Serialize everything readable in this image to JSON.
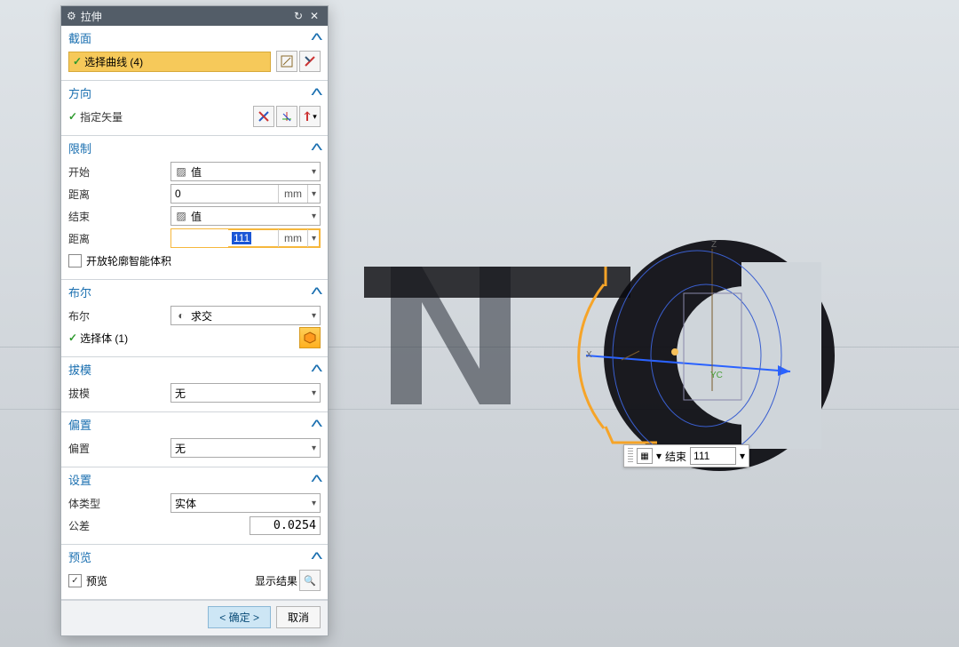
{
  "dialog": {
    "title": "拉伸",
    "sections": {
      "section_profile": {
        "title": "截面",
        "selectCurve": "选择曲线 (4)"
      },
      "section_direction": {
        "title": "方向",
        "specifyVector": "指定矢量"
      },
      "section_limits": {
        "title": "限制",
        "start": "开始",
        "startVal": "值",
        "distance": "距离",
        "startDistance": "0",
        "end": "结束",
        "endVal": "值",
        "endDistance": "111",
        "unit": "mm",
        "openSmart": "开放轮廓智能体积"
      },
      "section_bool": {
        "title": "布尔",
        "label": "布尔",
        "value": "求交",
        "selectBody": "选择体 (1)"
      },
      "section_draft": {
        "title": "拔模",
        "label": "拔模",
        "value": "无"
      },
      "section_offset": {
        "title": "偏置",
        "label": "偏置",
        "value": "无"
      },
      "section_settings": {
        "title": "设置",
        "bodyType": "体类型",
        "bodyTypeVal": "实体",
        "tolerance": "公差",
        "toleranceVal": "0.0254"
      },
      "section_preview": {
        "title": "预览",
        "checkbox": "预览",
        "showResult": "显示结果"
      }
    },
    "footer": {
      "ok_prefix": "< ",
      "ok": "确定",
      "ok_suffix": " >",
      "cancel": "取消"
    }
  },
  "viewport": {
    "floatingBar": {
      "label": "结束",
      "value": "111"
    }
  }
}
